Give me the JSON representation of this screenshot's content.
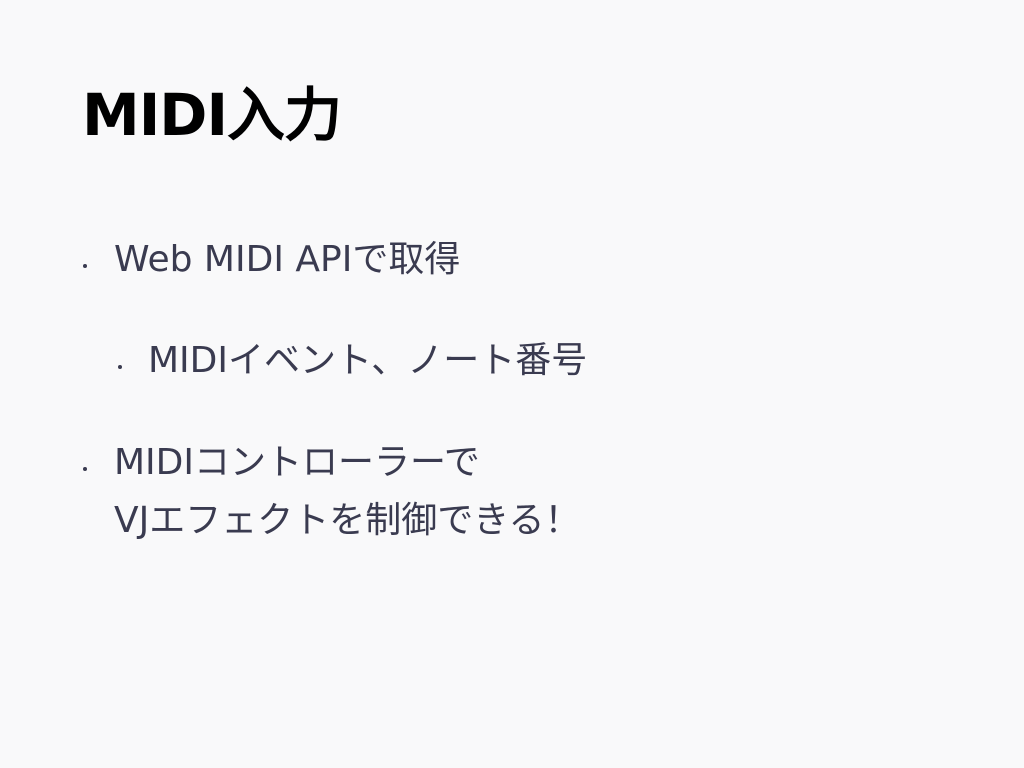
{
  "slide": {
    "title": "MIDI入力",
    "bullets": [
      {
        "text": "Web MIDI APIで取得"
      },
      {
        "text": "MIDIイベント、ノート番号"
      },
      {
        "line1": "MIDIコントローラーで",
        "line2": "VJエフェクトを制御できる！"
      }
    ]
  }
}
